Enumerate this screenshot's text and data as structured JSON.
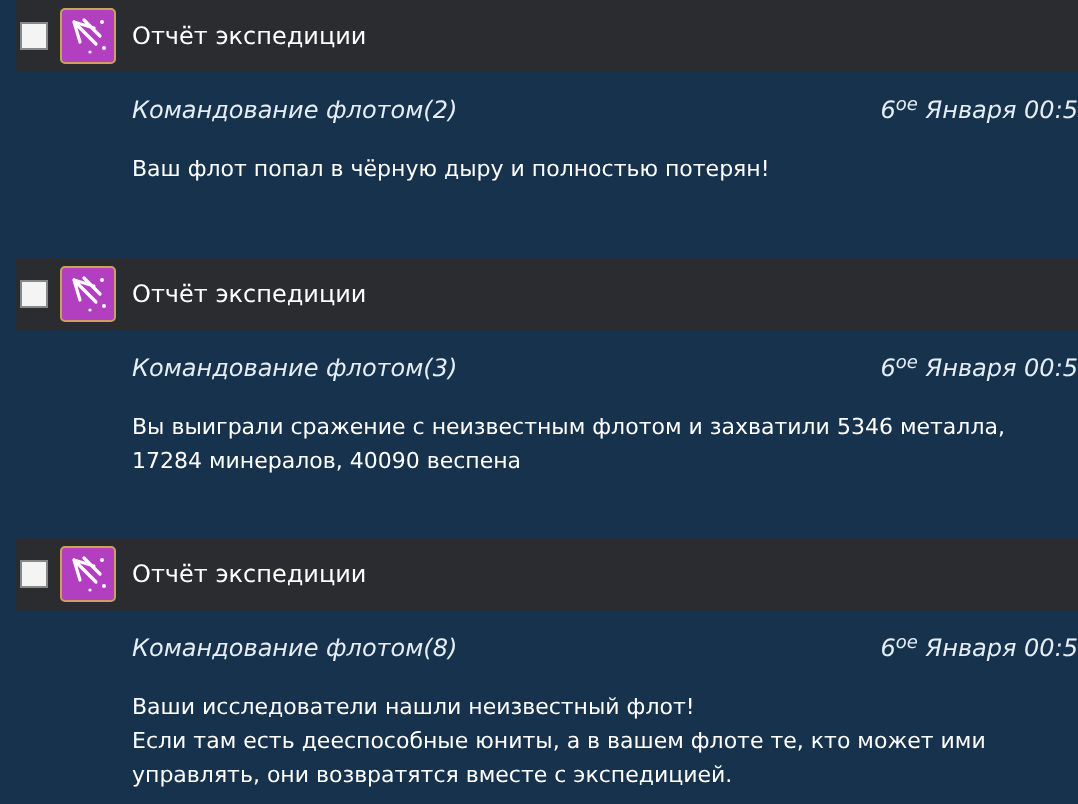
{
  "messages": [
    {
      "checked": false,
      "title": "Отчёт экспедиции",
      "sender": "Командование флотом(2)",
      "date": "6$^{ое}$ Января 00:5",
      "body": [
        "Ваш флот попал в чёрную дыру и полностью потерян!"
      ]
    },
    {
      "checked": false,
      "title": "Отчёт экспедиции",
      "sender": "Командование флотом(3)",
      "date": "6$^{ое}$ Января 00:5",
      "body": [
        "Вы выиграли сражение с неизвестным флотом и захватили 5346 металла, 17284 минералов, 40090 веспена"
      ]
    },
    {
      "checked": false,
      "title": "Отчёт экспедиции",
      "sender": "Командование флотом(8)",
      "date": "6$^{ое}$ Января 00:5",
      "body": [
        "Ваши исследователи нашли неизвестный флот!",
        "Если там есть дееспособные юниты, а в вашем флоте те, кто может ими управлять, они возвратятся вместе с экспедицией."
      ]
    }
  ]
}
